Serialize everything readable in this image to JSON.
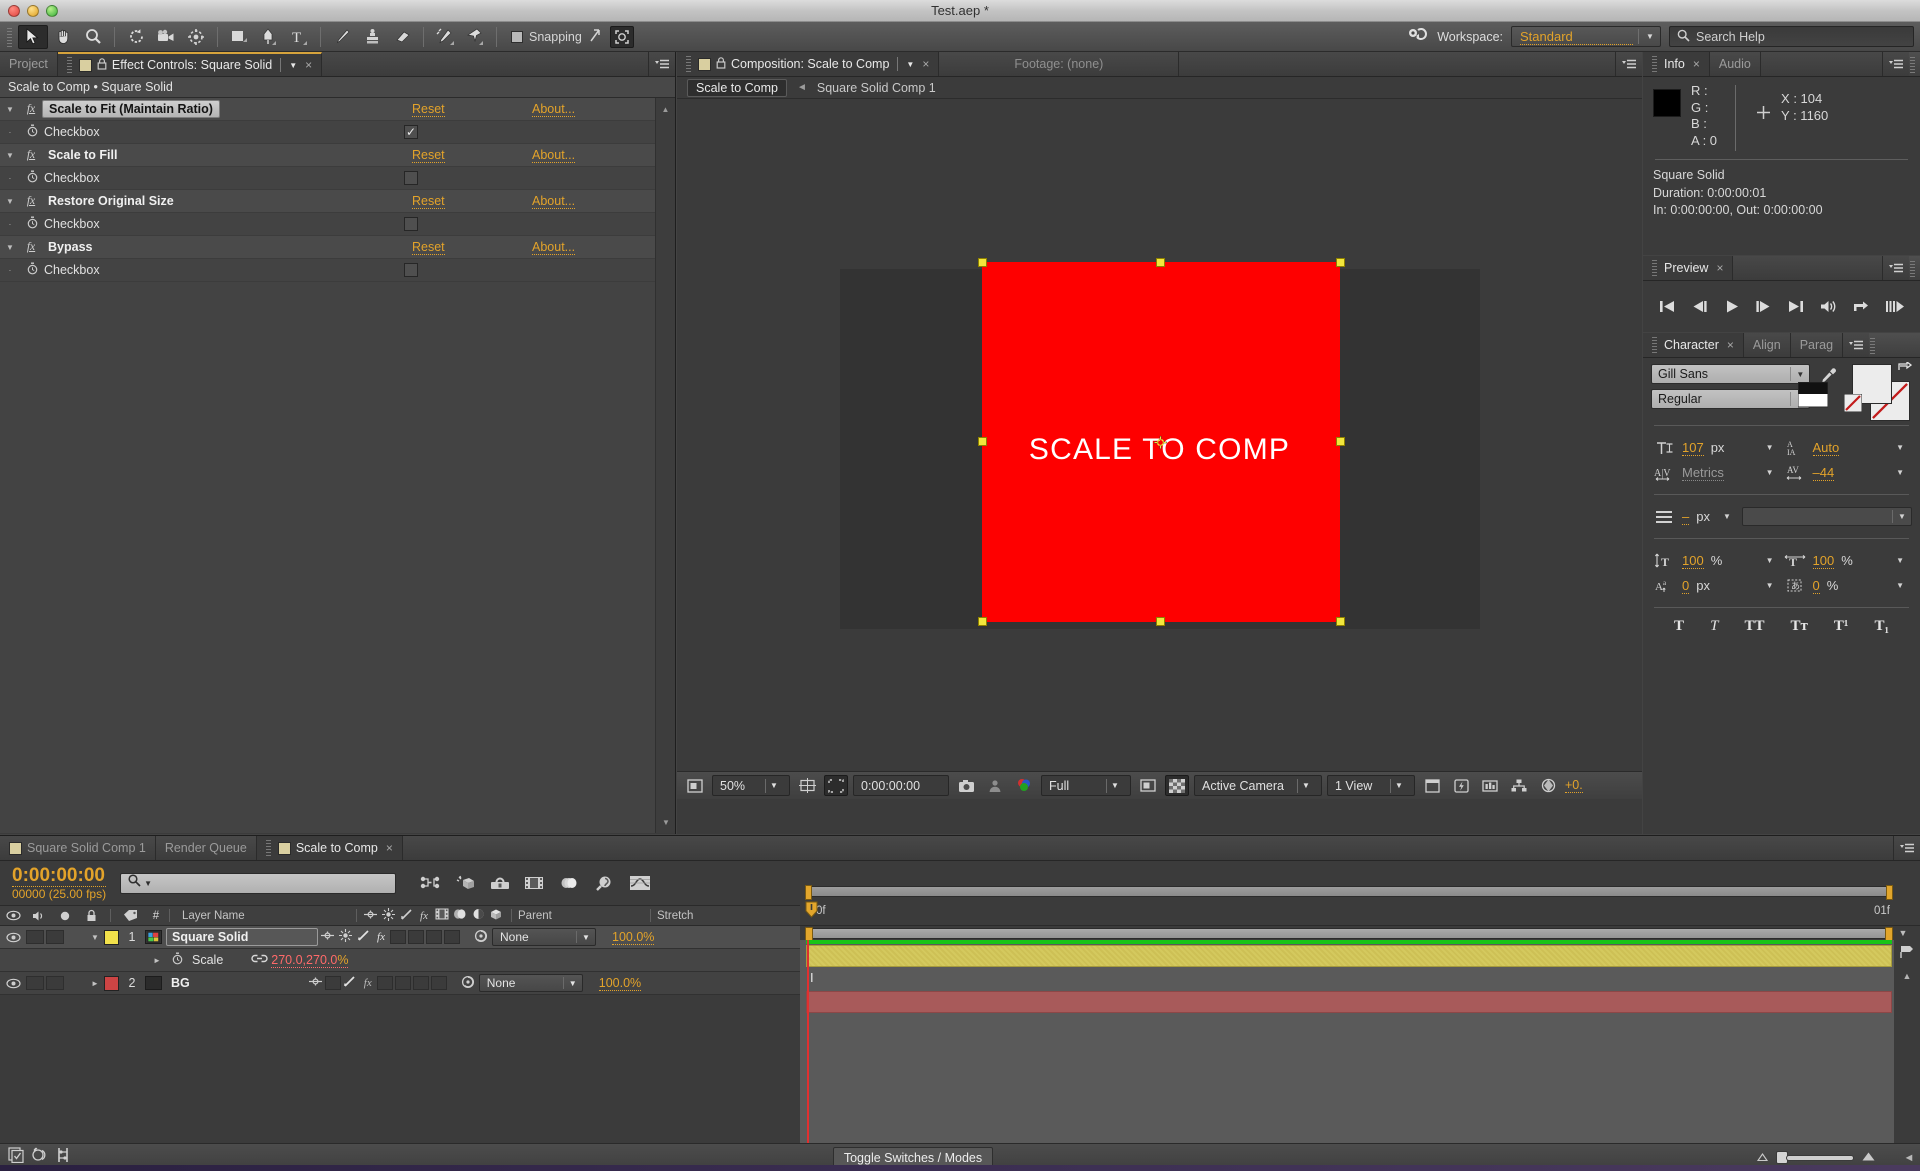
{
  "window": {
    "title": "Test.aep *"
  },
  "toolbar": {
    "tools": [
      {
        "name": "selection-tool",
        "selected": true
      },
      {
        "name": "hand-tool",
        "selected": false
      },
      {
        "name": "zoom-tool",
        "selected": false
      },
      {
        "name": "rotation-tool",
        "selected": false
      },
      {
        "name": "camera-tool",
        "selected": false
      },
      {
        "name": "pan-behind-tool",
        "selected": false
      },
      {
        "name": "shape-tool",
        "selected": false
      },
      {
        "name": "pen-tool",
        "selected": false
      },
      {
        "name": "type-tool",
        "selected": false
      },
      {
        "name": "brush-tool",
        "selected": false
      },
      {
        "name": "clone-stamp-tool",
        "selected": false
      },
      {
        "name": "eraser-tool",
        "selected": false
      },
      {
        "name": "roto-brush-tool",
        "selected": false
      },
      {
        "name": "puppet-pin-tool",
        "selected": false
      }
    ],
    "snapping_label": "Snapping",
    "snapping_checked": false,
    "workspace_label": "Workspace:",
    "workspace_value": "Standard",
    "search_help_placeholder": "Search Help"
  },
  "effect_controls": {
    "tabs": [
      {
        "label": "Project",
        "active": false
      },
      {
        "label": "Effect Controls: Square Solid",
        "active": true
      }
    ],
    "header": "Scale to Comp • Square Solid",
    "reset_label": "Reset",
    "about_label": "About...",
    "checkbox_label": "Checkbox",
    "effects": [
      {
        "name": "Scale to Fit (Maintain Ratio)",
        "highlighted": true,
        "checked": true
      },
      {
        "name": "Scale to Fill",
        "highlighted": false,
        "checked": false
      },
      {
        "name": "Restore Original Size",
        "highlighted": false,
        "checked": false
      },
      {
        "name": "Bypass",
        "highlighted": false,
        "checked": false
      }
    ]
  },
  "composition": {
    "tabs": [
      {
        "label": "Composition: Scale to Comp",
        "active": true
      },
      {
        "label": "Footage: (none)",
        "active": false
      }
    ],
    "breadcrumb_current": "Scale to Comp",
    "breadcrumb_parent": "Square Solid Comp 1",
    "canvas_text": "SCALE TO COMP",
    "solid_color": "#fe0000",
    "controls": {
      "zoom": "50%",
      "time": "0:00:00:00",
      "resolution": "Full",
      "view": "Active Camera",
      "view_count": "1 View",
      "exposure": "+0."
    }
  },
  "info": {
    "tabs": [
      {
        "label": "Info",
        "active": true
      },
      {
        "label": "Audio",
        "active": false
      }
    ],
    "r": "R :",
    "g": "G :",
    "b": "B :",
    "a": "A : 0",
    "x": "X : 104",
    "y": "Y : 1160",
    "layer_name": "Square Solid",
    "duration": "Duration: 0:00:00:01",
    "inout": "In: 0:00:00:00, Out: 0:00:00:00"
  },
  "preview": {
    "tabs": [
      {
        "label": "Preview",
        "active": true
      }
    ],
    "buttons": [
      "first-frame-icon",
      "previous-frame-icon",
      "play-icon",
      "next-frame-icon",
      "last-frame-icon",
      "audio-icon",
      "loop-icon",
      "ram-preview-icon"
    ]
  },
  "character": {
    "tabs": [
      {
        "label": "Character",
        "active": true
      },
      {
        "label": "Align",
        "active": false
      },
      {
        "label": "Parag",
        "active": false
      }
    ],
    "font_family": "Gill Sans",
    "font_style": "Regular",
    "font_size": "107",
    "font_size_unit": "px",
    "leading": "Auto",
    "kerning": "Metrics",
    "tracking": "–44",
    "stroke_width": "–",
    "stroke_width_unit": "px",
    "stroke_type": "",
    "vertical_scale": "100",
    "vertical_scale_unit": "%",
    "horizontal_scale": "100",
    "horizontal_scale_unit": "%",
    "baseline_shift": "0",
    "baseline_shift_unit": "px",
    "tsume": "0",
    "tsume_unit": "%",
    "styles": [
      "T",
      "T",
      "TT",
      "Tт",
      "T¹",
      "T₁"
    ]
  },
  "timeline": {
    "tabs": [
      {
        "label": "Square Solid Comp 1",
        "active": false,
        "swatch": "#d9cfa0"
      },
      {
        "label": "Render Queue",
        "active": false,
        "swatch": null
      },
      {
        "label": "Scale to Comp",
        "active": true,
        "swatch": "#d9cfa0"
      }
    ],
    "current_time": "0:00:00:00",
    "frame_info": "00000 (25.00 fps)",
    "columns": {
      "number": "#",
      "layer_name": "Layer Name",
      "parent": "Parent",
      "stretch": "Stretch"
    },
    "layers": [
      {
        "index": "1",
        "name": "Square Solid",
        "color": "#f2e14b",
        "parent": "None",
        "stretch": "100.0%",
        "selected": true,
        "bar_color": "#d4c95e"
      },
      {
        "index": "2",
        "name": "BG",
        "color": "#cc4444",
        "parent": "None",
        "stretch": "100.0%",
        "selected": false,
        "bar_color": "#a85a5a"
      }
    ],
    "property": {
      "name": "Scale",
      "value": "270.0,270.0",
      "unit": "%"
    },
    "ruler_start": "0f",
    "ruler_end": "01f",
    "toggle_switches_label": "Toggle Switches / Modes"
  }
}
